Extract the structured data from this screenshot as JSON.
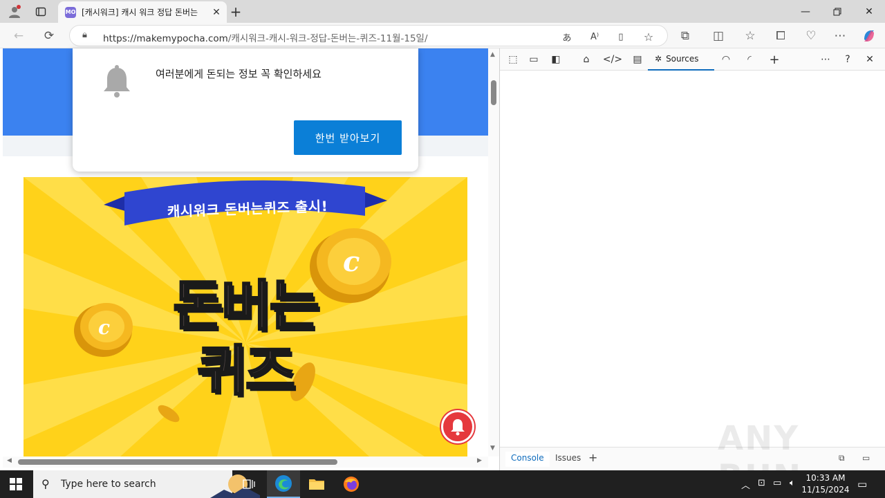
{
  "browser": {
    "tab_title": "[캐시워크] 캐시 워크 정답 돈버는",
    "tab_favicon": "MO",
    "url_domain": "https://makemypocha.com",
    "url_path": "/캐시워크-캐시-워크-정답-돈버는-퀴즈-11월-15일/"
  },
  "popup": {
    "message": "여러분에게 돈되는 정보 꼭 확인하세요",
    "button": "한번 받아보기"
  },
  "banner": {
    "ribbon": "캐시워크 돈버는퀴즈 출시!",
    "line1": "돈버는",
    "line2": "퀴즈"
  },
  "devtools": {
    "active_tab": "Sources",
    "bottom_tabs": [
      "Console",
      "Issues"
    ]
  },
  "watermark": "ANY RUN",
  "taskbar": {
    "search_placeholder": "Type here to search",
    "time": "10:33 AM",
    "date": "11/15/2024"
  },
  "colors": {
    "hero_blue": "#3b82f0",
    "banner_yellow": "#ffd21a",
    "popup_button": "#0b7fd7",
    "notify_red": "#e5383d"
  }
}
